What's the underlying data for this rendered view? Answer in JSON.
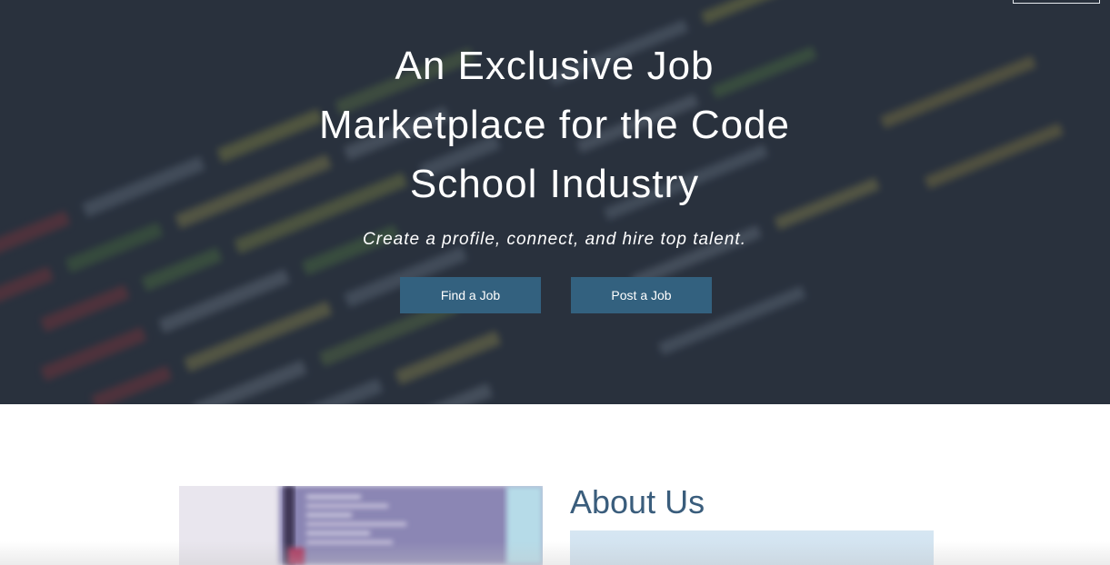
{
  "hero": {
    "title_line1": "An Exclusive Job",
    "title_line2": "Marketplace for the Code",
    "title_line3": "School Industry",
    "subtitle": "Create a profile, connect, and hire top talent.",
    "find_job_label": "Find a Job",
    "post_job_label": "Post a Job"
  },
  "about": {
    "heading": "About Us"
  },
  "colors": {
    "hero_background": "#2a333f",
    "button_background": "#33617f",
    "heading_color": "#3a5d7c"
  }
}
